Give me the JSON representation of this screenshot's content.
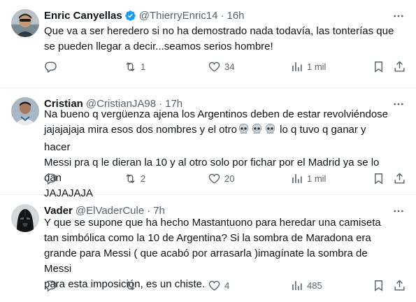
{
  "tweets": [
    {
      "name": "Enric Canyellas",
      "verified": true,
      "handle": "@ThierryEnric14",
      "separator": "·",
      "time": "16h",
      "text": "Que va a ser heredero si no ha demostrado nada todavía, las tonterías que\nse pueden llegar a decir...seamos serios hombre!",
      "replies": "",
      "retweets": "1",
      "likes": "34",
      "views": "1 mil",
      "avatar_icon": "sunglasses-man-avatar"
    },
    {
      "name": "Cristian",
      "verified": false,
      "handle": "@CristianJA98",
      "separator": "·",
      "time": "17h",
      "text_line1": "Na bueno q vergüenza ajena los Argentinos deben de estar revolviéndose",
      "text_line2a": "jajajajaja mira esos dos nombres y el otro",
      "text_line2b": " lo q tuvo q ganar y hacer",
      "text_line3": "Messi pra q le dieran la 10 y al otro solo por fichar por el Madrid ya se lo dan",
      "text_line4": "JAJAJAJA",
      "emoji": [
        "skull-emoji",
        "skull-emoji",
        "skull-emoji"
      ],
      "replies": "",
      "retweets": "2",
      "likes": "20",
      "views": "1 mil",
      "avatar_icon": "player-avatar"
    },
    {
      "name": "Vader",
      "verified": false,
      "handle": "@ElVaderCule",
      "separator": "·",
      "time": "7h",
      "text": "Y que se supone que ha hecho Mastantuono para heredar una camiseta\ntan simbólica como la 10 de Argentina? Si la sombra de Maradona era\ngrande para Messi ( que acabó por arrasarla )imagínate la sombra de Messi\npara esta imposición, es un chiste.",
      "replies": "",
      "retweets": "",
      "likes": "4",
      "views": "485",
      "avatar_icon": "darth-vader-avatar"
    }
  ],
  "colors": {
    "text": "#0f1419",
    "secondary": "#536471",
    "verified": "#1d9bf0",
    "divider": "#eff3f4"
  },
  "icons": [
    "reply-icon",
    "retweet-icon",
    "like-icon",
    "views-icon",
    "bookmark-icon",
    "share-icon",
    "more-icon",
    "verified-badge-icon"
  ]
}
